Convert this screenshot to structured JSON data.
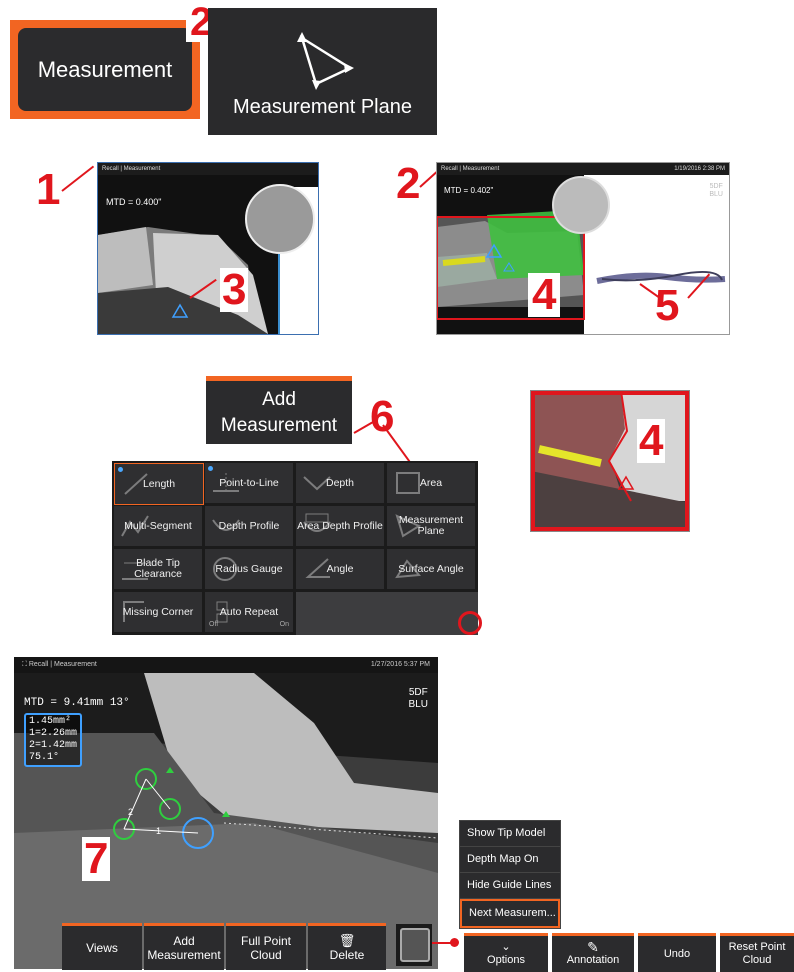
{
  "top": {
    "measurement_label": "Measurement",
    "measurement_plane_label": "Measurement Plane"
  },
  "callouts": {
    "c1": "1",
    "c2a": "2",
    "c2b": "2",
    "c3": "3",
    "c4a": "4",
    "c4b": "4",
    "c5": "5",
    "c6": "6",
    "c7": "7"
  },
  "screen1": {
    "breadcrumb": "Recall | Measurement",
    "mtd": "MTD = 0.400\""
  },
  "screen2": {
    "breadcrumb": "Recall | Measurement",
    "date": "1/19/2016 2:38 PM",
    "mtd": "MTD = 0.402\"",
    "tag1": "5DF",
    "tag2": "BLU"
  },
  "add_measurement": {
    "line1": "Add",
    "line2": "Measurement"
  },
  "grid": [
    {
      "label": "Length",
      "icon": "length-icon"
    },
    {
      "label": "Point-to-Line",
      "icon": "point-to-line-icon"
    },
    {
      "label": "Depth",
      "icon": "depth-icon"
    },
    {
      "label": "Area",
      "icon": "area-icon"
    },
    {
      "label": "Multi-Segment",
      "icon": "multi-segment-icon"
    },
    {
      "label": "Depth Profile",
      "icon": "depth-profile-icon"
    },
    {
      "label": "Area Depth Profile",
      "icon": "area-depth-profile-icon"
    },
    {
      "label": "Measurement Plane",
      "icon": "measurement-plane-icon"
    },
    {
      "label": "Blade Tip Clearance",
      "icon": "blade-tip-icon"
    },
    {
      "label": "Radius Gauge",
      "icon": "radius-gauge-icon"
    },
    {
      "label": "Angle",
      "icon": "angle-icon"
    },
    {
      "label": "Surface Angle",
      "icon": "surface-angle-icon"
    },
    {
      "label": "Missing Corner",
      "icon": "missing-corner-icon"
    },
    {
      "label": "Auto Repeat",
      "icon": "auto-repeat-icon"
    }
  ],
  "auto_repeat": {
    "off": "Off",
    "on": "On"
  },
  "screen3": {
    "breadcrumb": "Recall | Measurement",
    "date": "1/27/2016 5:37 PM",
    "mtd": "MTD = 9.41mm 13°",
    "results": [
      "1.45mm²",
      "1=2.26mm",
      "2=1.42mm",
      "75.1°"
    ],
    "tag1": "5DF",
    "tag2": "BLU",
    "pt1": "1",
    "pt2": "2"
  },
  "bottom_bar": {
    "views": "Views",
    "add_l1": "Add",
    "add_l2": "Measurement",
    "full_l1": "Full Point",
    "full_l2": "Cloud",
    "delete": "Delete"
  },
  "options_menu": [
    "Show Tip Model",
    "Depth Map On",
    "Hide Guide Lines",
    "Next Measurem..."
  ],
  "right_bar": {
    "options": "Options",
    "annotation": "Annotation",
    "undo": "Undo",
    "reset_l1": "Reset Point",
    "reset_l2": "Cloud"
  },
  "colors": {
    "accent": "#f26522",
    "callout": "#e0161d",
    "panel": "#2b2b2d"
  }
}
